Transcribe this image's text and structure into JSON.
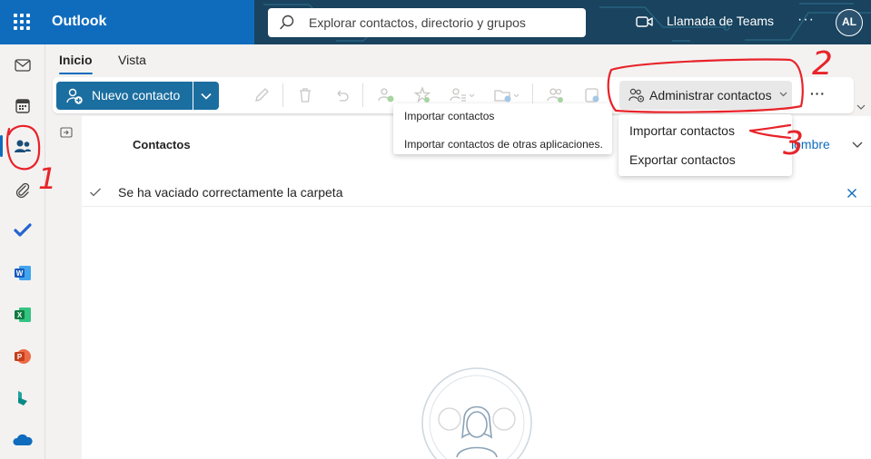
{
  "app": {
    "brand": "Outlook",
    "search_placeholder": "Explorar contactos, directorio y grupos",
    "teams_label": "Llamada de Teams",
    "avatar_initials": "AL"
  },
  "ribbon": {
    "tabs": [
      {
        "label": "Inicio",
        "active": true
      },
      {
        "label": "Vista",
        "active": false
      }
    ],
    "new_contact_label": "Nuevo contacto",
    "admin_label": "Administrar contactos",
    "more_label": "···"
  },
  "menus": {
    "primary": [
      "Importar contactos",
      "Importar contactos de otras aplicaciones."
    ],
    "admin": [
      "Importar contactos",
      "Exportar contactos"
    ]
  },
  "list": {
    "title": "Contactos",
    "sort_label": "or nombre"
  },
  "notice": {
    "text": "Se ha vaciado correctamente la carpeta"
  },
  "annotations": [
    "1",
    "2",
    "3"
  ],
  "colors": {
    "accent": "#0f6cbd",
    "primary_button": "#1b6ea0",
    "annotation": "#e8232a"
  }
}
